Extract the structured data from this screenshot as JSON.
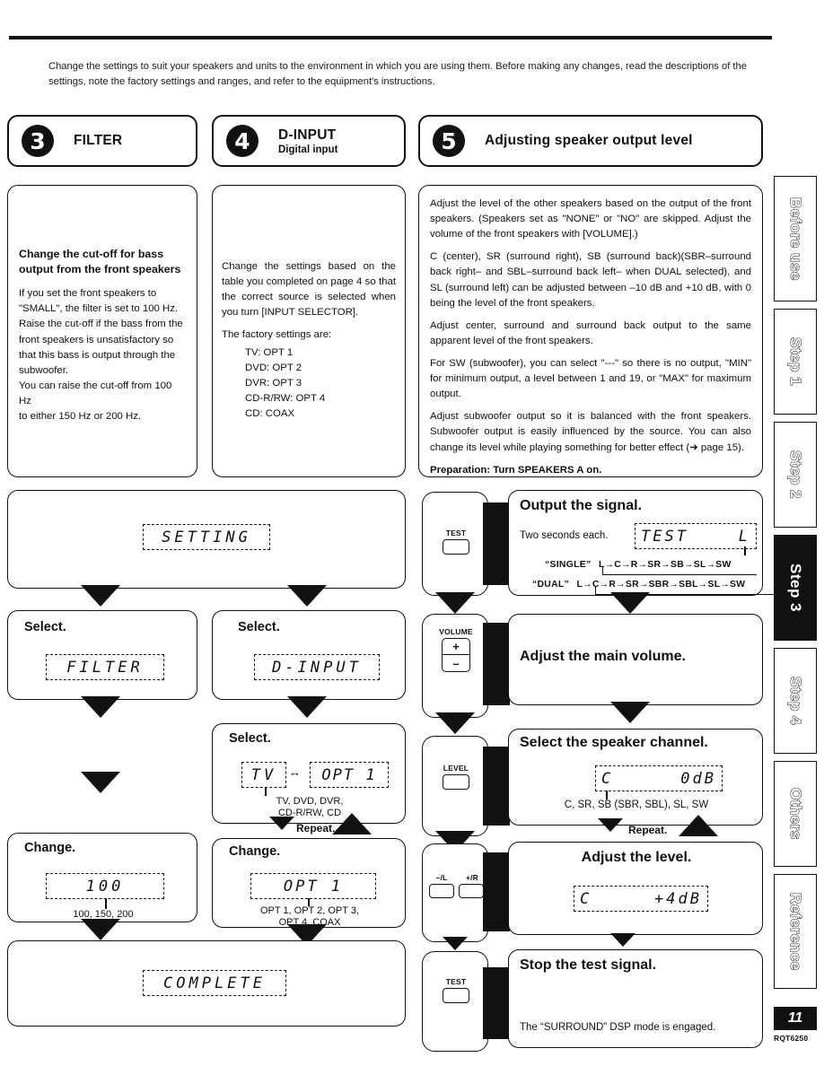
{
  "intro": "Change the settings to suit your speakers and units to the environment in which you are using them. Before making any changes, read the descriptions of the settings, note the factory settings and ranges, and refer to the equipment's instructions.",
  "sections": [
    {
      "number": "3",
      "title": "FILTER",
      "subtitle": ""
    },
    {
      "number": "4",
      "title": "D-INPUT",
      "subtitle": "Digital input"
    },
    {
      "number": "5",
      "title": "Adjusting speaker output level",
      "subtitle": ""
    }
  ],
  "filter": {
    "heading": "Change the cut-off for bass output from the front speakers",
    "body": "If you set the front speakers to \"SMALL\", the filter is set to 100 Hz. Raise the cut-off if the bass from the front speakers is unsatisfactory so that this bass is output through the subwoofer.\nYou can raise the cut-off from 100 Hz to either 150 Hz or 200 Hz.",
    "body_line1": "If you set the front speakers to",
    "body_line2": "\"SMALL\", the filter is set to 100 Hz.",
    "body_line3": "Raise the cut-off if the bass from the",
    "body_line4": "front speakers is unsatisfactory so",
    "body_line5": "that this bass is output through the",
    "body_line6": "subwoofer.",
    "body_line7": "You can raise the cut-off from 100 Hz",
    "body_line8": "to either 150 Hz or 200 Hz.",
    "select_label": "Select.",
    "select_lcd": "FILTER",
    "change_label": "Change.",
    "change_lcd": "100",
    "change_options": "100, 150, 200"
  },
  "dinput": {
    "body_p1": "Change the settings based on the table you completed on page 4 so that the correct source is selected when you turn [INPUT SELECTOR].",
    "body_p2": "The factory settings are:",
    "factory": [
      "TV: OPT 1",
      "DVD: OPT 2",
      "DVR: OPT 3",
      "CD-R/RW: OPT 4",
      "CD: COAX"
    ],
    "select1_label": "Select.",
    "select1_lcd": "D-INPUT",
    "select2_label": "Select.",
    "select2_lcd_left": "TV",
    "select2_lcd_right": "OPT 1",
    "select2_options_line1": "TV, DVD, DVR,",
    "select2_options_line2": "CD-R/RW, CD",
    "repeat_label": "Repeat.",
    "change_label": "Change.",
    "change_lcd": "OPT 1",
    "change_options_line1": "OPT 1, OPT 2, OPT 3,",
    "change_options_line2": "OPT 4, COAX"
  },
  "level": {
    "p1": "Adjust the level of the other speakers based on the output of the front speakers. (Speakers set as \"NONE\" or \"NO\" are skipped. Adjust the volume of the front speakers with [VOLUME].)",
    "p2": "C (center), SR (surround right), SB (surround back)(SBR–surround back right– and SBL–surround back left– when DUAL selected), and SL (surround left) can be adjusted between –10 dB and +10 dB, with 0 being the level of the front speakers.",
    "p3": "Adjust center, surround and surround back output to the same apparent level of the front speakers.",
    "p4": "For SW (subwoofer), you can select \"---\" so there is no output, \"MIN\" for minimum output, a level between 1 and 19, or \"MAX\" for maximum output.",
    "p5": "Adjust subwoofer output so it is balanced with the front speakers. Subwoofer output is easily influenced by the source. You can also change its level while playing something for better effect (➜ page 15).",
    "preparation": "Preparation: Turn SPEAKERS A on.",
    "steps": [
      {
        "key": "TEST",
        "title": "Output the signal.",
        "note": "Two seconds each.",
        "lcd_left": "TEST",
        "lcd_right": "L",
        "chain_single_label": "“SINGLE”",
        "chain_single": "L→C→R→SR→SB→SL→SW",
        "chain_dual_label": "“DUAL”",
        "chain_dual": "L→C→R→SR→SBR→SBL→SL→SW"
      },
      {
        "key": "VOLUME",
        "key_plus": "+",
        "key_minus": "–",
        "title": "Adjust the main volume."
      },
      {
        "key": "LEVEL",
        "title": "Select the speaker channel.",
        "lcd_left": "C",
        "lcd_right": "0dB",
        "options": "C, SR, SB (SBR, SBL), SL, SW",
        "repeat_label": "Repeat."
      },
      {
        "key_minus_l": "–/L",
        "key_plus_r": "+/R",
        "title": "Adjust the level.",
        "lcd_left": "C",
        "lcd_right": "+4dB"
      },
      {
        "key": "TEST",
        "title": "Stop the test signal.",
        "note": "The “SURROUND” DSP mode is engaged."
      }
    ]
  },
  "complete_lcd": "COMPLETE",
  "setting_lcd": "SETTING",
  "sidebar": {
    "tabs": [
      {
        "label": "Before use",
        "active": false
      },
      {
        "label": "Step 1",
        "active": false
      },
      {
        "label": "Step 2",
        "active": false
      },
      {
        "label": "Step 3",
        "active": true
      },
      {
        "label": "Step 4",
        "active": false
      },
      {
        "label": "Others",
        "active": false
      },
      {
        "label": "Reference",
        "active": false
      }
    ],
    "page_number": "11",
    "doc_code": "RQT6250"
  }
}
